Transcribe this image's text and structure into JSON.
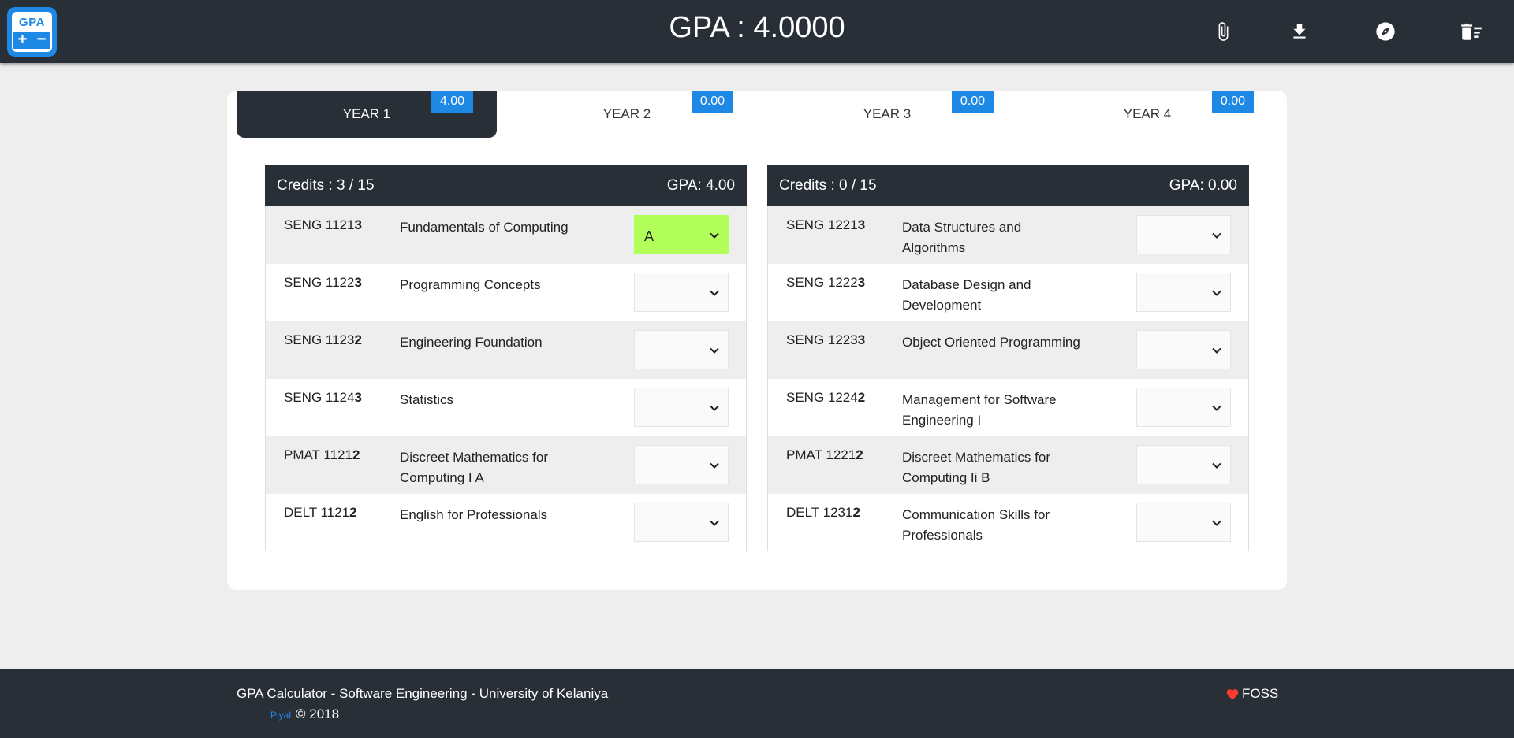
{
  "header": {
    "logo_text": "GPA",
    "logo_plus": "+",
    "logo_minus": "−",
    "title": "GPA : 4.0000",
    "actions": [
      {
        "name": "attach",
        "icon": "paperclip-icon"
      },
      {
        "name": "download",
        "icon": "download-icon"
      },
      {
        "name": "explore",
        "icon": "compass-icon"
      },
      {
        "name": "clear",
        "icon": "clear-all-icon"
      }
    ]
  },
  "tabs": [
    {
      "label": "YEAR 1",
      "badge": "4.00",
      "active": true
    },
    {
      "label": "YEAR 2",
      "badge": "0.00",
      "active": false
    },
    {
      "label": "YEAR 3",
      "badge": "0.00",
      "active": false
    },
    {
      "label": "YEAR 4",
      "badge": "0.00",
      "active": false
    }
  ],
  "semesters": [
    {
      "credits": "Credits : 3 / 15",
      "gpa": "GPA: 4.00",
      "courses": [
        {
          "code_prefix": "SENG 1121",
          "code_credit": "3",
          "name": "Fundamentals of Computing",
          "grade": "A"
        },
        {
          "code_prefix": "SENG 1122",
          "code_credit": "3",
          "name": "Programming Concepts",
          "grade": ""
        },
        {
          "code_prefix": "SENG 1123",
          "code_credit": "2",
          "name": "Engineering Foundation",
          "grade": ""
        },
        {
          "code_prefix": "SENG 1124",
          "code_credit": "3",
          "name": "Statistics",
          "grade": ""
        },
        {
          "code_prefix": "PMAT 1121",
          "code_credit": "2",
          "name": "Discreet Mathematics for Computing I A",
          "grade": ""
        },
        {
          "code_prefix": "DELT 1121",
          "code_credit": "2",
          "name": "English for Professionals",
          "grade": ""
        }
      ]
    },
    {
      "credits": "Credits : 0 / 15",
      "gpa": "GPA: 0.00",
      "courses": [
        {
          "code_prefix": "SENG 1221",
          "code_credit": "3",
          "name": "Data Structures and Algorithms",
          "grade": ""
        },
        {
          "code_prefix": "SENG 1222",
          "code_credit": "3",
          "name": "Database Design and Development",
          "grade": ""
        },
        {
          "code_prefix": "SENG 1223",
          "code_credit": "3",
          "name": "Object Oriented Programming",
          "grade": ""
        },
        {
          "code_prefix": "SENG 1224",
          "code_credit": "2",
          "name": "Management for Software Engineering I",
          "grade": ""
        },
        {
          "code_prefix": "PMAT 1221",
          "code_credit": "2",
          "name": "Discreet Mathematics for Computing Ii B",
          "grade": ""
        },
        {
          "code_prefix": "DELT 1231",
          "code_credit": "2",
          "name": "Communication Skills for Professionals",
          "grade": ""
        }
      ]
    }
  ],
  "footer": {
    "title": "GPA Calculator - Software Engineering - University of Kelaniya",
    "author": "Piyal",
    "copyright": "© 2018",
    "foss": "FOSS",
    "heart_icon": "heart-icon"
  },
  "colors": {
    "dark": "#292f36",
    "accent": "#1e88e5",
    "selected_grade": "#b2ff59",
    "background": "#eeeeee"
  }
}
